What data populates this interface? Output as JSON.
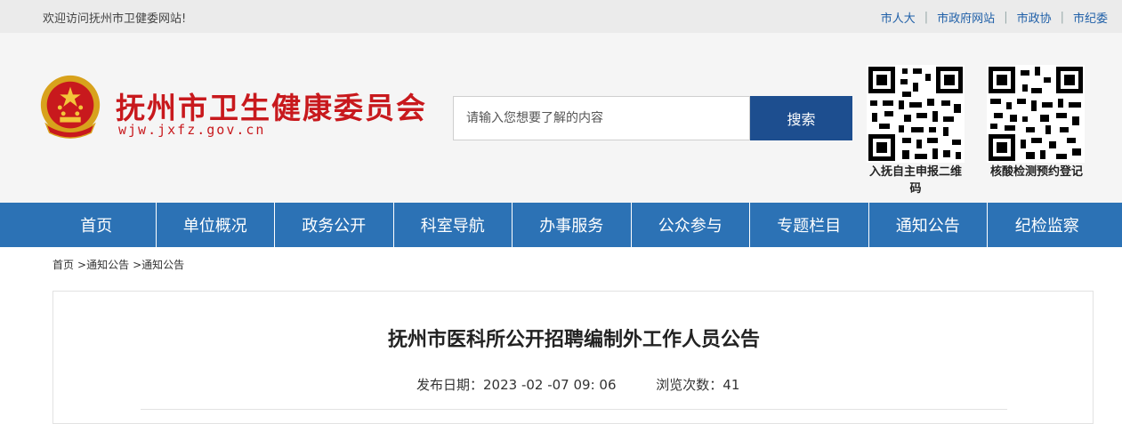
{
  "topbar": {
    "welcome": "欢迎访问抚州市卫健委网站!",
    "links": [
      "市人大",
      "市政府网站",
      "市政协",
      "市纪委"
    ],
    "separator": "|"
  },
  "header": {
    "title": "抚州市卫生健康委员会",
    "domain": "wjw.jxfz.gov.cn",
    "search": {
      "placeholder": "请输入您想要了解的内容",
      "button": "搜索"
    },
    "qrcodes": [
      {
        "caption": "入抚自主申报二维码",
        "icon": "qr-code-icon"
      },
      {
        "caption": "核酸检测预约登记",
        "icon": "qr-code-icon"
      }
    ],
    "emblem_icon": "national-emblem-icon"
  },
  "nav": {
    "items": [
      "首页",
      "单位概况",
      "政务公开",
      "科室导航",
      "办事服务",
      "公众参与",
      "专题栏目",
      "通知公告",
      "纪检监察"
    ]
  },
  "breadcrumb": [
    "首页",
    ">通知公告",
    ">通知公告"
  ],
  "article": {
    "title": "抚州市医科所公开招聘编制外工作人员公告",
    "publish_label": "发布日期：",
    "publish_date": "2023 -02 -07 09: 06",
    "views_label": "浏览次数：",
    "views": "41"
  },
  "colors": {
    "brand_red": "#c8191d",
    "nav_blue": "#2c72b5",
    "search_blue": "#1d4e8f"
  }
}
